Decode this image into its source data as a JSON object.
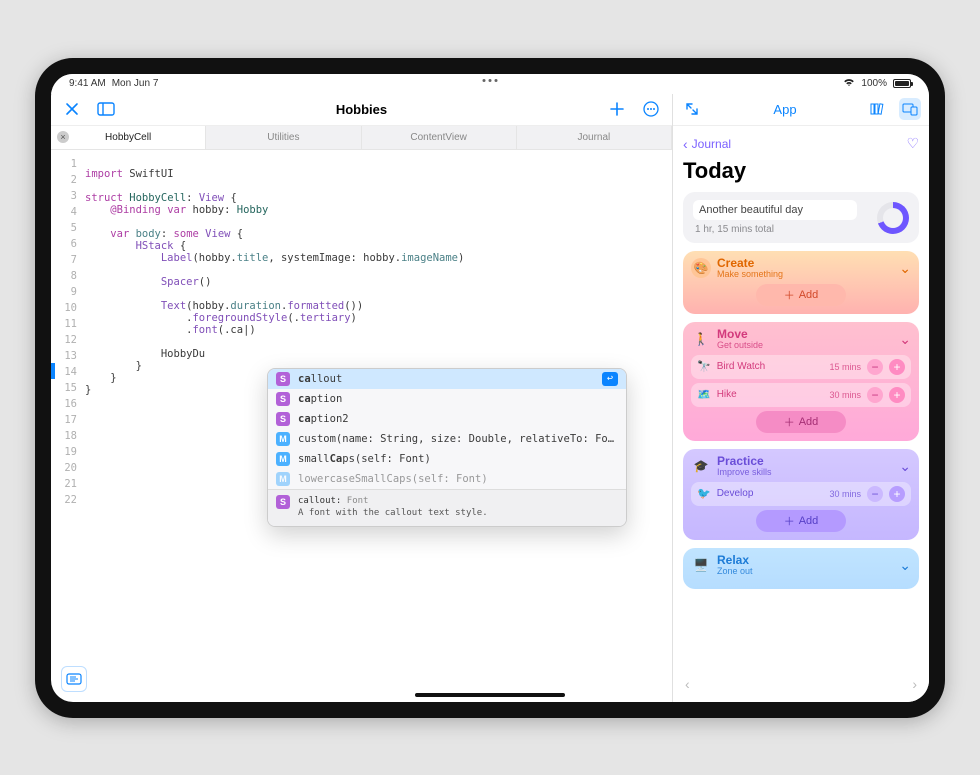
{
  "status": {
    "time": "9:41 AM",
    "date": "Mon Jun 7",
    "battery": "100%"
  },
  "left": {
    "title": "Hobbies",
    "tabs": [
      "HobbyCell",
      "Utilities",
      "ContentView",
      "Journal"
    ]
  },
  "right": {
    "title": "App",
    "back": "Journal",
    "heading": "Today",
    "summary_text": "Another beautiful day",
    "summary_sub": "1 hr, 15 mins total",
    "create": {
      "title": "Create",
      "sub": "Make something",
      "add": "Add"
    },
    "move": {
      "title": "Move",
      "sub": "Get outside",
      "add": "Add",
      "rows": [
        {
          "label": "Bird Watch",
          "time": "15 mins"
        },
        {
          "label": "Hike",
          "time": "30 mins"
        }
      ]
    },
    "practice": {
      "title": "Practice",
      "sub": "Improve skills",
      "add": "Add",
      "rows": [
        {
          "label": "Develop",
          "time": "30 mins"
        }
      ]
    },
    "relax": {
      "title": "Relax",
      "sub": "Zone out"
    }
  },
  "ac": {
    "items": [
      {
        "badge": "S",
        "pre": "ca",
        "rest": "llout"
      },
      {
        "badge": "S",
        "pre": "ca",
        "rest": "ption"
      },
      {
        "badge": "S",
        "pre": "ca",
        "rest": "ption2"
      },
      {
        "badge": "M",
        "raw": "custom(name: String, size: Double, relativeTo: Fon…"
      },
      {
        "badge": "M",
        "raw": "smallCaps(self: Font)",
        "boldmid": "Ca"
      },
      {
        "badge": "M",
        "raw": "lowercaseSmallCaps(self: Font)"
      }
    ],
    "doctitle": "callout:",
    "doctype": "Font",
    "docdesc": "A font with the callout text style."
  },
  "code": {
    "l2a": "import",
    "l2b": "SwiftUI",
    "l4a": "struct",
    "l4b": "HobbyCell",
    "l4c": ":",
    "l4d": "View",
    "l4e": "{",
    "l5a": "@Binding",
    "l5b": "var",
    "l5c": "hobby",
    "l5d": ":",
    "l5e": "Hobby",
    "l7a": "var",
    "l7b": "body",
    "l7c": ":",
    "l7d": "some",
    "l7e": "View",
    "l7f": "{",
    "l8a": "HStack",
    "l8b": "{",
    "l9a": "Label",
    "l9b": "(hobby.",
    "l9c": "title",
    "l9d": ", systemImage: hobby.",
    "l9e": "imageName",
    "l9f": ")",
    "l11a": "Spacer",
    "l11b": "()",
    "l13a": "Text",
    "l13b": "(hobby.",
    "l13c": "duration",
    "l13d": ".",
    "l13e": "formatted",
    "l13f": "())",
    "l14a": ".",
    "l14b": "foregroundStyle",
    "l14c": "(.",
    "l14d": "tertiary",
    "l14e": ")",
    "l15a": ".",
    "l15b": "font",
    "l15c": "(.ca",
    "l15d": ")",
    "l17a": "HobbyDu",
    "l18a": "}",
    "l19a": "}",
    "l20a": "}"
  }
}
